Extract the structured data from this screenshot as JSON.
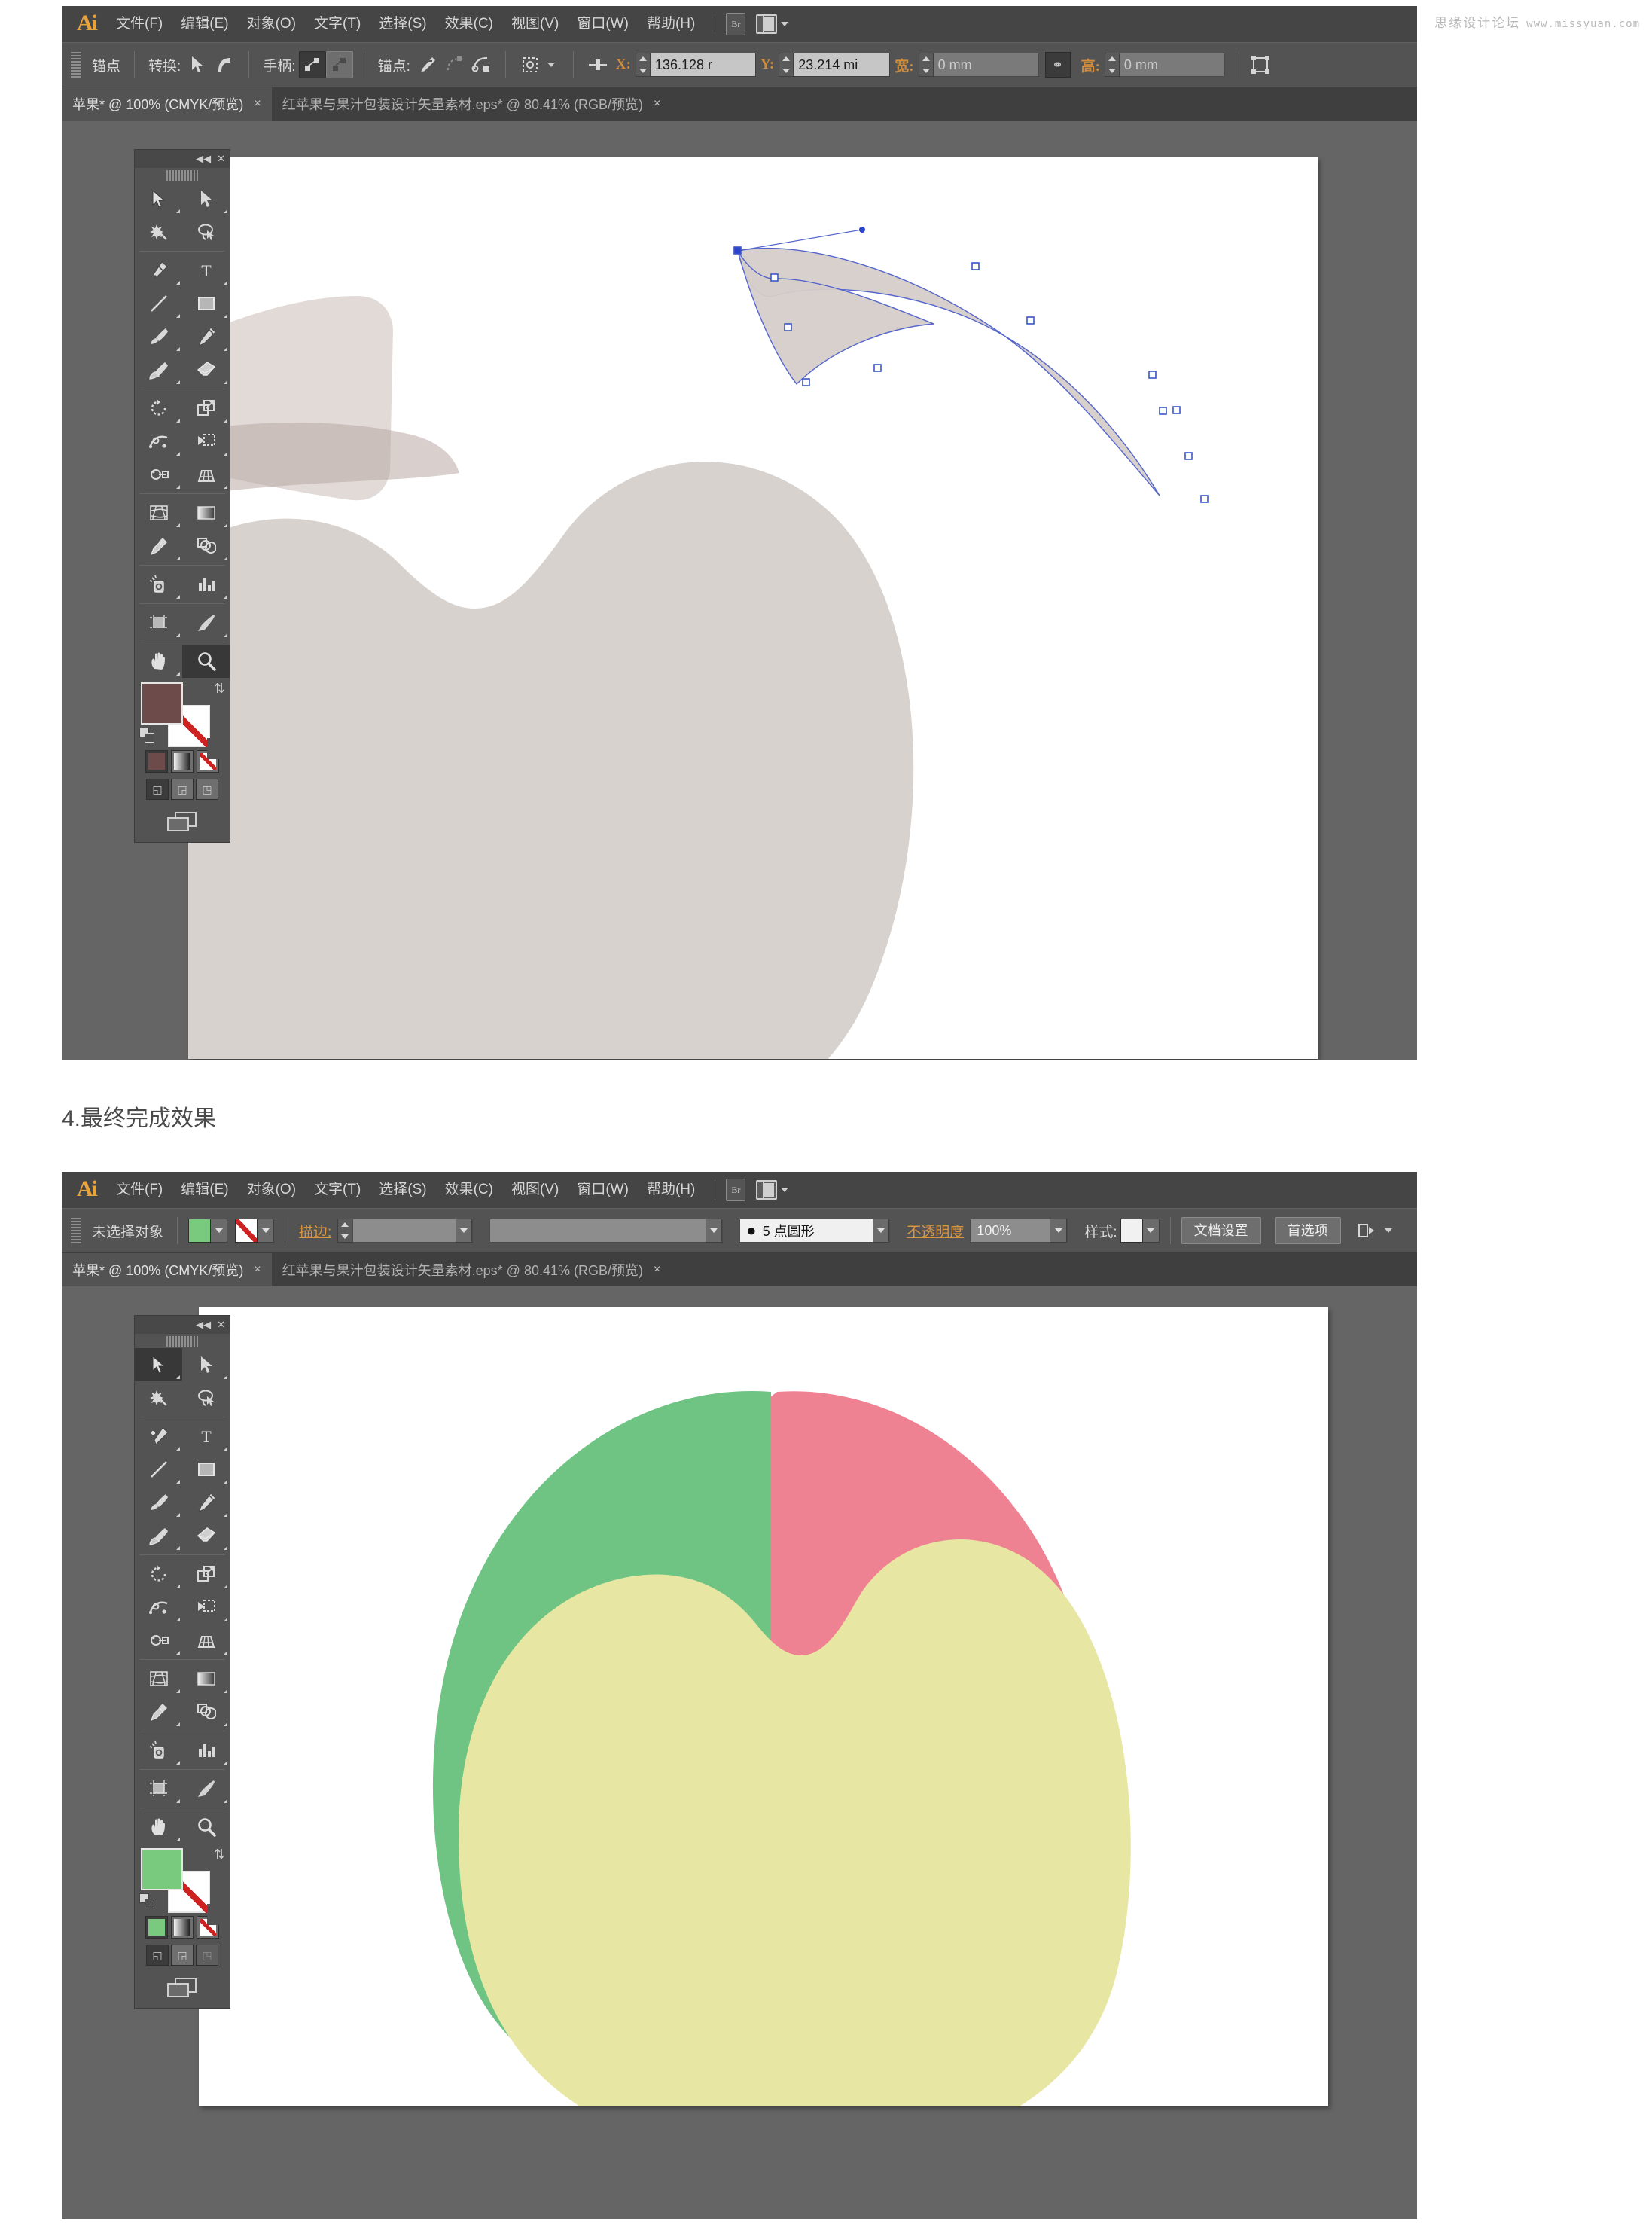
{
  "watermark": {
    "cn": "思缘设计论坛",
    "url": "www.missyuan.com"
  },
  "caption": {
    "text": "4.最终完成效果"
  },
  "menu": {
    "logo": "Ai",
    "items": [
      "文件(F)",
      "编辑(E)",
      "对象(O)",
      "文字(T)",
      "选择(S)",
      "效果(C)",
      "视图(V)",
      "窗口(W)",
      "帮助(H)"
    ],
    "bridge_label": "Br"
  },
  "tabs": [
    {
      "label": "苹果* @ 100% (CMYK/预览)",
      "close": "×",
      "active": true
    },
    {
      "label": "红苹果与果汁包装设计矢量素材.eps* @ 80.41% (RGB/预览)",
      "close": "×",
      "active": false
    }
  ],
  "screenshot_a": {
    "control_bar": {
      "selection_label": "锚点",
      "convert_label": "转换:",
      "handles_label": "手柄:",
      "anchor_label": "锚点:",
      "x_label": "X:",
      "x_value": "136.128 r",
      "y_label": "Y:",
      "y_value": "23.214 mi",
      "width_label": "宽:",
      "width_value": "0 mm",
      "height_label": "高:",
      "height_value": "0 mm",
      "link_icon": "⚭"
    },
    "fill_color": "#6d4b4b",
    "active_tool": "zoom-tool"
  },
  "screenshot_b": {
    "control_bar": {
      "selection_label": "未选择对象",
      "fill_color": "#79c97e",
      "stroke_color": "none",
      "stroke_label": "描边:",
      "stroke_weight": "",
      "brush_label": "",
      "profile_label": "5 点圆形",
      "opacity_label": "不透明度",
      "opacity_value": "100%",
      "style_label": "样式:",
      "doc_setup_label": "文档设置",
      "preferences_label": "首选项"
    },
    "fill_color": "#79c97e",
    "active_tool": "selection-tool"
  },
  "tools": {
    "panel_collapse": "◀◀",
    "panel_close": "✕",
    "rows": [
      [
        {
          "name": "selection-tool",
          "glyph": "cursor"
        },
        {
          "name": "direct-selection-tool",
          "glyph": "cursor-solid"
        }
      ],
      [
        {
          "name": "magic-wand-tool",
          "glyph": "wand"
        },
        {
          "name": "lasso-tool",
          "glyph": "lasso"
        }
      ],
      [
        {
          "name": "pen-tool",
          "glyph": "pen"
        },
        {
          "name": "type-tool",
          "glyph": "T"
        }
      ],
      [
        {
          "name": "line-segment-tool",
          "glyph": "line"
        },
        {
          "name": "rectangle-tool",
          "glyph": "rect"
        }
      ],
      [
        {
          "name": "paintbrush-tool",
          "glyph": "brush"
        },
        {
          "name": "pencil-tool",
          "glyph": "pencil"
        }
      ],
      [
        {
          "name": "blob-brush-tool",
          "glyph": "blob"
        },
        {
          "name": "eraser-tool",
          "glyph": "eraser"
        }
      ],
      [
        {
          "name": "rotate-tool",
          "glyph": "rotate"
        },
        {
          "name": "scale-tool",
          "glyph": "scale"
        }
      ],
      [
        {
          "name": "width-tool",
          "glyph": "width"
        },
        {
          "name": "free-transform-tool",
          "glyph": "free"
        }
      ],
      [
        {
          "name": "shape-builder-tool",
          "glyph": "shapebuilder"
        },
        {
          "name": "perspective-grid-tool",
          "glyph": "perspective"
        }
      ],
      [
        {
          "name": "mesh-tool",
          "glyph": "mesh"
        },
        {
          "name": "gradient-tool",
          "glyph": "gradient"
        }
      ],
      [
        {
          "name": "eyedropper-tool",
          "glyph": "eyedropper"
        },
        {
          "name": "blend-tool",
          "glyph": "blend"
        }
      ],
      [
        {
          "name": "symbol-sprayer-tool",
          "glyph": "sprayer"
        },
        {
          "name": "column-graph-tool",
          "glyph": "graph"
        }
      ],
      [
        {
          "name": "artboard-tool",
          "glyph": "artboard"
        },
        {
          "name": "slice-tool",
          "glyph": "slice"
        }
      ],
      [
        {
          "name": "hand-tool",
          "glyph": "hand"
        },
        {
          "name": "zoom-tool",
          "glyph": "zoom"
        }
      ]
    ]
  },
  "artwork": {
    "leaf_fill": "#d6cdc9",
    "leaf_stroke": "#5566cc",
    "apple_body_a": "#d8d2ce",
    "apple_shadow_a": "#6a625f",
    "apple_green": "#6fc484",
    "apple_red": "#ef8292",
    "apple_yellow": "#e7e6a2"
  }
}
